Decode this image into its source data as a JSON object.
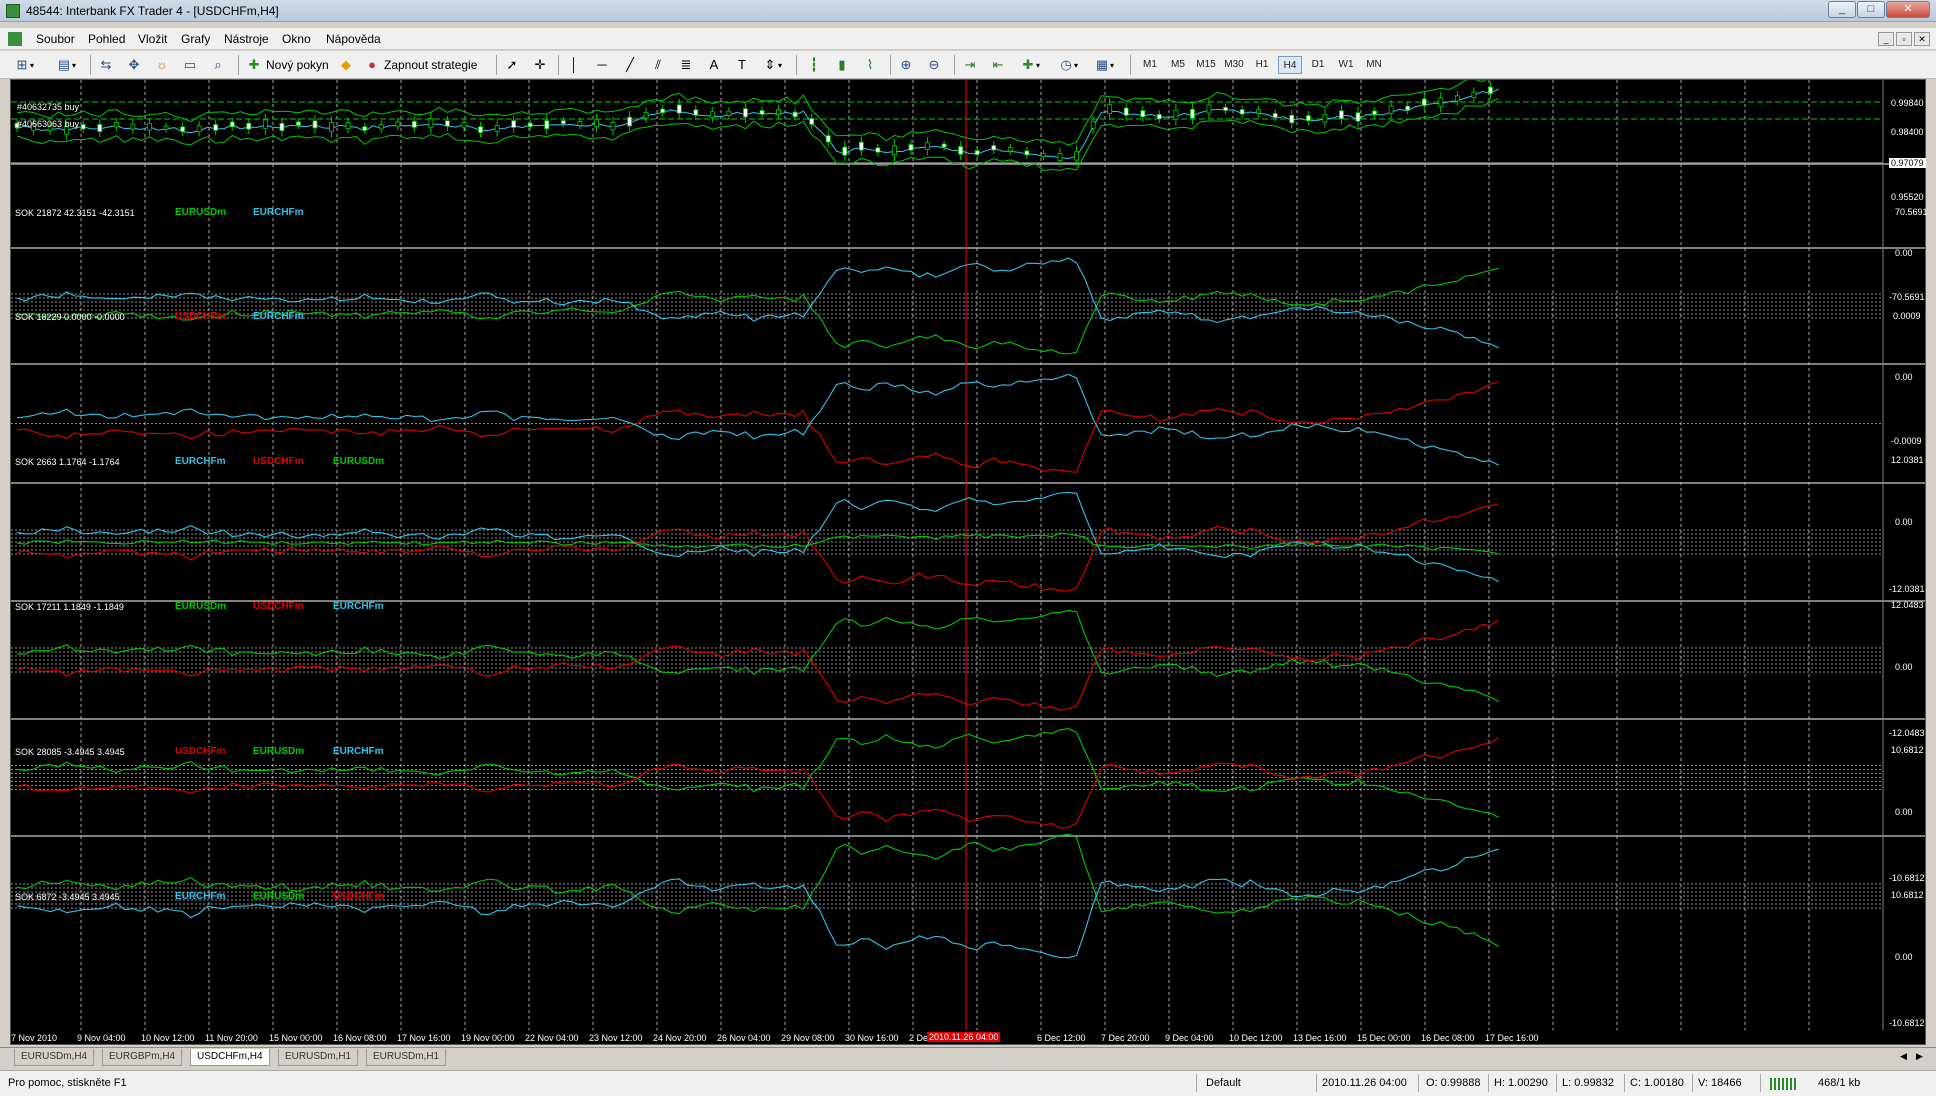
{
  "window": {
    "title": "48544: Interbank FX Trader 4 - [USDCHFm,H4]",
    "controls": [
      "_",
      "□",
      "✕"
    ]
  },
  "menu": {
    "items": [
      "Soubor",
      "Pohled",
      "Vložit",
      "Grafy",
      "Nástroje",
      "Okno",
      "Nápověda"
    ],
    "mdi_controls": [
      "_",
      "▫",
      "✕"
    ]
  },
  "toolbar": {
    "new_order_label": "Nový pokyn",
    "strategy_label": "Zapnout strategie",
    "timeframes": [
      "M1",
      "M5",
      "M15",
      "M30",
      "H1",
      "H4",
      "D1",
      "W1",
      "MN"
    ],
    "active_timeframe": "H4",
    "icons": [
      "new-chart-icon",
      "profiles-icon",
      "market-watch-icon",
      "navigator-icon",
      "terminal-icon",
      "tester-icon",
      "history-icon",
      "new-order-icon",
      "expert-icon",
      "cursor-icon",
      "crosshair-icon",
      "vline-icon",
      "hline-icon",
      "trendline-icon",
      "channel-icon",
      "fibo-icon",
      "text-icon",
      "label-icon",
      "arrows-icon",
      "bar-chart-icon",
      "candle-chart-icon",
      "line-chart-icon",
      "zoom-in-icon",
      "zoom-out-icon",
      "autoscroll-icon",
      "chart-shift-icon",
      "indicators-icon",
      "periods-icon",
      "templates-icon"
    ]
  },
  "chart": {
    "symbol": "USDCHFm,H4",
    "orders": [
      "#40632735 buy",
      "#40663063 buy"
    ],
    "price_axis": [
      "0.99840",
      "0.98400",
      "0.97079",
      "0.95520"
    ],
    "current_price": "0.97079",
    "colors": {
      "green": "#00c800",
      "cyan": "#33c3e8",
      "red": "#e00000",
      "grid": "#c8c8c8",
      "background": "#000000",
      "candle_bull": "#ffffff",
      "candle_bear": "#000000",
      "ma": "#00c800"
    },
    "indicator_panes": [
      {
        "header": "SOK 21872 42.3151 -42.3151",
        "pairs": [
          {
            "name": "EURUSDm",
            "color": "#00c800"
          },
          {
            "name": "EURCHFm",
            "color": "#33c3e8"
          }
        ],
        "axis": [
          "70.5691",
          "0.00",
          "-70.5691"
        ]
      },
      {
        "header": "SOK 18229 0.0000 -0.0000",
        "pairs": [
          {
            "name": "USDCHFm",
            "color": "#e00000"
          },
          {
            "name": "EURCHFm",
            "color": "#33c3e8"
          }
        ],
        "axis": [
          "0.0009",
          "0.00",
          "-0.0009"
        ]
      },
      {
        "header": "SOK 2663 1.1764 -1.1764",
        "pairs": [
          {
            "name": "EURCHFm",
            "color": "#33c3e8"
          },
          {
            "name": "USDCHFm",
            "color": "#e00000"
          },
          {
            "name": "EURUSDm",
            "color": "#00c800"
          }
        ],
        "axis": [
          "12.0381",
          "0.00",
          "-12.0381"
        ]
      },
      {
        "header": "SOK 17211 1.1849 -1.1849",
        "pairs": [
          {
            "name": "EURUSDm",
            "color": "#00c800"
          },
          {
            "name": "USDCHFm",
            "color": "#e00000"
          },
          {
            "name": "EURCHFm",
            "color": "#33c3e8"
          }
        ],
        "axis": [
          "12.0483",
          "0.00",
          "-12.0483"
        ]
      },
      {
        "header": "SOK 28085 -3.4945 3.4945",
        "pairs": [
          {
            "name": "USDCHFm",
            "color": "#e00000"
          },
          {
            "name": "EURUSDm",
            "color": "#00c800"
          },
          {
            "name": "EURCHFm",
            "color": "#33c3e8"
          }
        ],
        "axis": [
          "10.6812",
          "0.00",
          "-10.6812"
        ]
      },
      {
        "header": "SOK 6872 -3.4945 3.4945",
        "pairs": [
          {
            "name": "EURCHFm",
            "color": "#33c3e8"
          },
          {
            "name": "EURUSDm",
            "color": "#00c800"
          },
          {
            "name": "USDCHFm",
            "color": "#e00000"
          }
        ],
        "axis": [
          "10.6812",
          "0.00",
          "-10.6812"
        ]
      }
    ],
    "time_axis": [
      "7 Nov 2010",
      "9 Nov 04:00",
      "10 Nov 12:00",
      "11 Nov 20:00",
      "15 Nov 00:00",
      "16 Nov 08:00",
      "17 Nov 16:00",
      "19 Nov 00:00",
      "22 Nov 04:00",
      "23 Nov 12:00",
      "24 Nov 20:00",
      "26 Nov 04:00",
      "29 Nov 08:00",
      "30 Nov 16:00",
      "2 Dec",
      "6 Dec 12:00",
      "7 Dec 20:00",
      "9 Dec 04:00",
      "10 Dec 12:00",
      "13 Dec 16:00",
      "15 Dec 00:00",
      "16 Dec 08:00",
      "17 Dec 16:00"
    ],
    "cursor_time": "2010.11.26 04:00"
  },
  "tabs": {
    "items": [
      "EURUSDm,H4",
      "EURGBPm,H4",
      "USDCHFm,H4",
      "EURUSDm,H1",
      "EURUSDm,H1"
    ],
    "active": "USDCHFm,H4"
  },
  "status": {
    "help": "Pro pomoc, stiskněte F1",
    "profile": "Default",
    "datetime": "2010.11.26 04:00",
    "open": "O: 0.99888",
    "high": "H: 1.00290",
    "low": "L: 0.99832",
    "close": "C: 1.00180",
    "volume": "V: 18466",
    "traffic": "468/1 kb"
  }
}
